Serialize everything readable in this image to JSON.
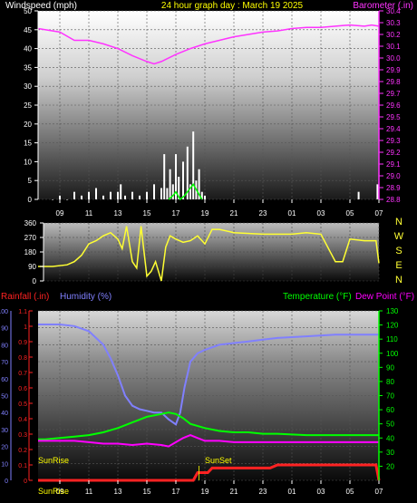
{
  "colors": {
    "wind": "#ffffff",
    "gust": "#00ff00",
    "barometer": "#ff33ff",
    "direction": "#ffff33",
    "rainfall": "#ff2222",
    "humidity": "#8080ff",
    "temperature": "#00ff00",
    "dewpoint": "#ff00ff",
    "solar": "#ffff00",
    "axis_text": "#ffffff"
  },
  "header": {
    "left_label": "Windspeed (mph)",
    "title": "24 hour graph day : March 19 2025",
    "right_label": "Barometer (.in)"
  },
  "time_labels": [
    "09",
    "11",
    "13",
    "15",
    "17",
    "19",
    "21",
    "23",
    "01",
    "03",
    "05",
    "07"
  ],
  "compass_labels": [
    "N",
    "W",
    "S",
    "E",
    "N"
  ],
  "chart_data": [
    {
      "type": "line",
      "name": "wind_and_barometer",
      "x_ticks": [
        "09",
        "11",
        "13",
        "15",
        "17",
        "19",
        "21",
        "23",
        "01",
        "03",
        "05",
        "07"
      ],
      "y_left": {
        "label": "Windspeed (mph)",
        "ticks": [
          0,
          5,
          10,
          15,
          20,
          25,
          30,
          35,
          40,
          45,
          50
        ],
        "range": [
          0,
          50
        ]
      },
      "y_right": {
        "label": "Barometer (.in)",
        "ticks": [
          28.8,
          28.9,
          29.0,
          29.1,
          29.2,
          29.3,
          29.4,
          29.5,
          29.6,
          29.7,
          29.8,
          29.9,
          30.0,
          30.1,
          30.2,
          30.3,
          30.4
        ],
        "range": [
          28.8,
          30.4
        ]
      },
      "barometer": {
        "hours": [
          7.5,
          9,
          10,
          11,
          12,
          13,
          14,
          15,
          15.5,
          16,
          17,
          18,
          19,
          20,
          21,
          22,
          23,
          24,
          25,
          26,
          27,
          28,
          29,
          30,
          30.5,
          31
        ],
        "values": [
          30.25,
          30.22,
          30.15,
          30.15,
          30.12,
          30.08,
          30.02,
          29.97,
          29.95,
          29.97,
          30.03,
          30.08,
          30.12,
          30.15,
          30.18,
          30.2,
          30.22,
          30.23,
          30.25,
          30.26,
          30.26,
          30.27,
          30.28,
          30.27,
          30.28,
          30.27
        ]
      },
      "wind": {
        "hours": [
          8.5,
          9,
          9.5,
          10,
          10.5,
          11,
          11.5,
          12,
          12.5,
          13,
          13.2,
          13.5,
          14,
          14.5,
          15,
          15.5,
          16,
          16.2,
          16.4,
          16.6,
          16.8,
          17,
          17.2,
          17.5,
          17.8,
          18,
          18.2,
          18.4,
          18.6,
          18.8,
          19,
          29.6,
          30.9
        ],
        "values": [
          0,
          1,
          0,
          2,
          1,
          2,
          3,
          1,
          2,
          2,
          4,
          1,
          2,
          1,
          2,
          4,
          3,
          12,
          3,
          8,
          4,
          12,
          6,
          10,
          14,
          4,
          18,
          5,
          8,
          2,
          1,
          2,
          4
        ]
      },
      "gust": {
        "hours": [
          16.5,
          16.8,
          17,
          17.3,
          17.6,
          18,
          18.2,
          18.5,
          18.8
        ],
        "values": [
          0,
          1,
          2,
          0,
          1,
          3,
          4,
          2,
          0
        ]
      }
    },
    {
      "type": "line",
      "name": "wind_direction",
      "y_ticks": [
        0,
        90,
        180,
        270,
        360
      ],
      "y_range": [
        0,
        360
      ],
      "hours": [
        7.5,
        8.5,
        9.5,
        10,
        10.5,
        11,
        11.5,
        12,
        12.5,
        13,
        13.3,
        13.6,
        14,
        14.3,
        14.6,
        15,
        15.3,
        15.6,
        16,
        16.3,
        16.6,
        17,
        17.5,
        18,
        18.5,
        19,
        19.5,
        20,
        21,
        23,
        25,
        26,
        27,
        28,
        28.5,
        29,
        30,
        30.8,
        31
      ],
      "values": [
        90,
        90,
        100,
        120,
        160,
        230,
        250,
        280,
        300,
        260,
        200,
        340,
        120,
        80,
        340,
        30,
        60,
        120,
        0,
        210,
        280,
        260,
        240,
        250,
        280,
        230,
        320,
        320,
        300,
        290,
        290,
        300,
        290,
        120,
        120,
        260,
        250,
        250,
        110
      ]
    },
    {
      "type": "line",
      "name": "rain_humidity_temperature",
      "x_ticks": [
        "09",
        "11",
        "13",
        "15",
        "17",
        "19",
        "21",
        "23",
        "01",
        "03",
        "05",
        "07"
      ],
      "y_rain": {
        "label": "Rainfall (.in)",
        "ticks": [
          0,
          0.1,
          0.2,
          0.3,
          0.4,
          0.5,
          0.6,
          0.7,
          0.8,
          0.9,
          1.0,
          1.1
        ],
        "range": [
          0,
          1.1
        ]
      },
      "y_humidity": {
        "label": "Humidity (%)",
        "ticks": [
          0,
          10,
          20,
          30,
          40,
          50,
          60,
          70,
          80,
          90,
          100
        ],
        "range": [
          0,
          100
        ]
      },
      "y_temp": {
        "label": "Temperature (°F)",
        "ticks": [
          20,
          30,
          40,
          50,
          60,
          70,
          80,
          90,
          100,
          110,
          120,
          130
        ],
        "range": [
          10,
          130
        ]
      },
      "dewpoint_label": "Dew Point (°F)",
      "humidity": {
        "hours": [
          7.5,
          8,
          9,
          10,
          11,
          12,
          12.5,
          13,
          13.5,
          14,
          14.5,
          15,
          15.5,
          16,
          16.5,
          17,
          17.3,
          17.6,
          18,
          18.5,
          19,
          20,
          21,
          22,
          23,
          24,
          26,
          28,
          29,
          30,
          31
        ],
        "values": [
          92,
          92,
          92,
          91,
          88,
          80,
          72,
          62,
          50,
          44,
          42,
          41,
          40,
          40,
          36,
          33,
          40,
          55,
          70,
          75,
          77,
          80,
          81,
          82,
          83,
          84,
          85,
          86,
          86,
          86,
          86
        ]
      },
      "temperature": {
        "hours": [
          7.5,
          8,
          9,
          10,
          11,
          12,
          13,
          14,
          15,
          16,
          16.5,
          17,
          17.5,
          18,
          19,
          20,
          21,
          22,
          23,
          24,
          26,
          28,
          29,
          30,
          31
        ],
        "values": [
          39,
          39,
          40,
          41,
          42,
          44,
          47,
          51,
          55,
          57,
          58,
          57,
          54,
          50,
          47,
          45,
          44,
          44,
          43,
          43,
          42,
          42,
          42,
          42,
          42
        ]
      },
      "dewpoint": {
        "hours": [
          7.5,
          8,
          9,
          10,
          11,
          12,
          13,
          14,
          15,
          16,
          16.5,
          17,
          17.5,
          18,
          18.5,
          19,
          20,
          21,
          23,
          25,
          27,
          29,
          30,
          31
        ],
        "values": [
          38,
          38,
          38,
          38,
          37,
          36,
          36,
          35,
          36,
          35,
          34,
          37,
          40,
          42,
          40,
          38,
          38,
          37,
          37,
          37,
          37,
          37,
          37,
          37
        ]
      },
      "rainfall": {
        "hours": [
          7.5,
          18.2,
          18.5,
          19.2,
          19.5,
          23.5,
          24,
          30.8,
          31
        ],
        "values": [
          0,
          0,
          0.05,
          0.05,
          0.08,
          0.08,
          0.1,
          0.1,
          0
        ]
      },
      "annotations": [
        "SunRise",
        "SunSet"
      ],
      "x_start_label": "SunRise"
    }
  ]
}
